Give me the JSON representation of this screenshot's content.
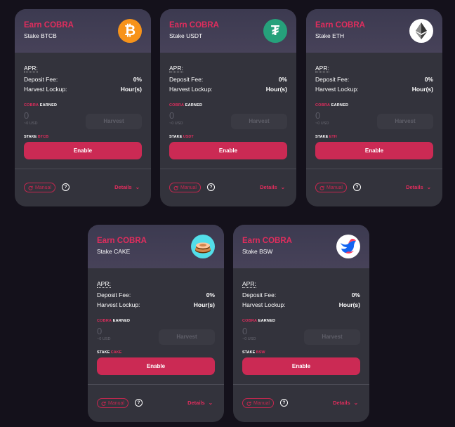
{
  "common": {
    "apr_label": "APR:",
    "deposit_fee_label": "Deposit Fee:",
    "deposit_fee_value": "0%",
    "harvest_lockup_label": "Harvest Lockup:",
    "harvest_lockup_value": "Hour(s)",
    "earned_token": "COBRA",
    "earned_word": "EARNED",
    "earned_value": "0",
    "earned_usd": "~0 USD",
    "harvest_label": "Harvest",
    "stake_word": "STAKE",
    "enable_label": "Enable",
    "manual_label": "Manual",
    "help_glyph": "?",
    "details_label": "Details",
    "details_chevron": "⌄"
  },
  "farms": [
    {
      "title": "Earn COBRA",
      "subtitle": "Stake BTCB",
      "token": "BTCB",
      "icon": "btcb-icon",
      "icon_glyph": "₿",
      "icon_color": "#f7931a"
    },
    {
      "title": "Earn COBRA",
      "subtitle": "Stake USDT",
      "token": "USDT",
      "icon": "usdt-icon",
      "icon_glyph": "₮",
      "icon_color": "#26a17b"
    },
    {
      "title": "Earn COBRA",
      "subtitle": "Stake ETH",
      "token": "ETH",
      "icon": "eth-icon",
      "icon_glyph": "◆",
      "icon_color": "#ffffff"
    },
    {
      "title": "Earn COBRA",
      "subtitle": "Stake CAKE",
      "token": "CAKE",
      "icon": "cake-icon",
      "icon_glyph": "",
      "icon_color": "#53dee9"
    },
    {
      "title": "Earn COBRA",
      "subtitle": "Stake BSW",
      "token": "BSW",
      "icon": "bsw-icon",
      "icon_glyph": "",
      "icon_color": "#ffffff"
    }
  ]
}
